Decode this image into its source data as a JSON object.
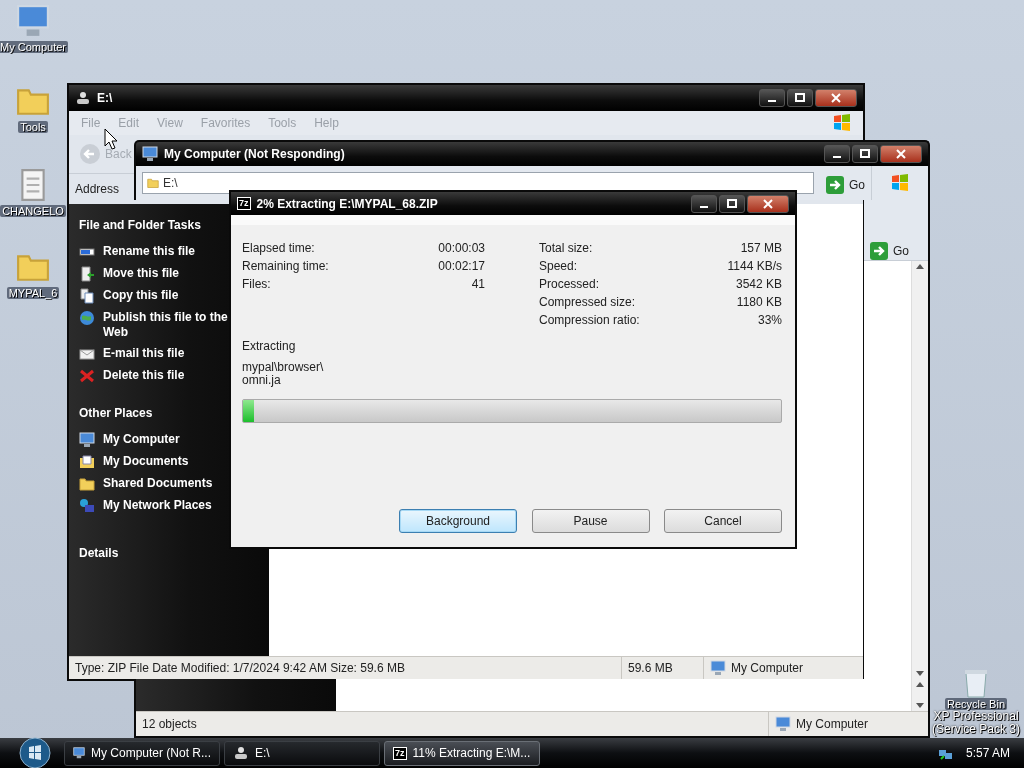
{
  "desktop": {
    "icons": [
      {
        "label": "My Computer",
        "kind": "computer"
      },
      {
        "label": "Tools",
        "kind": "folder"
      },
      {
        "label": "CHANGELO",
        "kind": "document"
      },
      {
        "label": "MYPAL_6",
        "kind": "folder"
      }
    ],
    "recycle_bin": {
      "label": "Recycle Bin"
    },
    "edition_text": [
      "XP Professional",
      "(Service Pack 3)"
    ]
  },
  "explorer_window": {
    "title": "E:\\",
    "menu": [
      "File",
      "Edit",
      "View",
      "Favorites",
      "Tools",
      "Help"
    ],
    "back_label": "Back",
    "address_label": "Address",
    "tasks": {
      "title": "File and Folder Tasks",
      "items": [
        {
          "label": "Rename this file",
          "kind": "rename"
        },
        {
          "label": "Move this file",
          "kind": "move"
        },
        {
          "label": "Copy this file",
          "kind": "copy"
        },
        {
          "label": "Publish this file to the Web",
          "kind": "publish"
        },
        {
          "label": "E-mail this file",
          "kind": "email"
        },
        {
          "label": "Delete this file",
          "kind": "delete"
        }
      ]
    },
    "other_places": {
      "title": "Other Places",
      "items": [
        {
          "label": "My Computer",
          "kind": "computer"
        },
        {
          "label": "My Documents",
          "kind": "documents"
        },
        {
          "label": "Shared Documents",
          "kind": "folder"
        },
        {
          "label": "My Network Places",
          "kind": "network"
        }
      ]
    },
    "details_title": "Details",
    "status_bar": [
      "Type: ZIP File Date Modified: 1/7/2024 9:42 AM Size: 59.6 MB",
      "59.6 MB",
      "My Computer"
    ]
  },
  "my_computer_window": {
    "title": "My Computer (Not Responding)",
    "address": "E:\\",
    "go_buttons": [
      "Go",
      "Go"
    ],
    "status_bar": [
      "12 objects",
      "My Computer"
    ]
  },
  "dialog": {
    "icon_text": "7z",
    "title": "2% Extracting E:\\MYPAL_68.ZIP",
    "stats_left": [
      {
        "label": "Elapsed time:",
        "value": "00:00:03"
      },
      {
        "label": "Remaining time:",
        "value": "00:02:17"
      },
      {
        "label": "Files:",
        "value": "41"
      }
    ],
    "stats_right": [
      {
        "label": "Total size:",
        "value": "157 MB"
      },
      {
        "label": "Speed:",
        "value": "1144 KB/s"
      },
      {
        "label": "Processed:",
        "value": "3542 KB"
      },
      {
        "label": "Compressed size:",
        "value": "1180 KB"
      },
      {
        "label": "Compression ratio:",
        "value": "33%"
      }
    ],
    "extracting_label": "Extracting",
    "path_lines": [
      "mypal\\browser\\",
      "omni.ja"
    ],
    "progress": {
      "level": 0.02
    },
    "buttons": [
      {
        "label": "Background",
        "focused": true
      },
      {
        "label": "Pause",
        "focused": false
      },
      {
        "label": "Cancel",
        "focused": false
      }
    ]
  },
  "taskbar": {
    "buttons": [
      {
        "label": "My Computer (Not R...",
        "kind": "computer",
        "selected": false
      },
      {
        "label": "E:\\",
        "kind": "drive",
        "selected": false
      },
      {
        "label": "11% Extracting E:\\M...",
        "kind": "archiver",
        "selected": true,
        "icon_text": "7z"
      }
    ],
    "clock": "5:57 AM"
  }
}
